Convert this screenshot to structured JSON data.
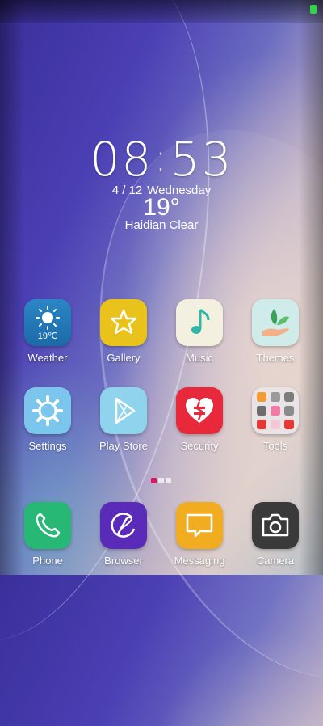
{
  "clock": {
    "hour": "08",
    "minute": "53",
    "date": "4 / 12",
    "weekday": "Wednesday",
    "temperature": "19°",
    "location": "Haidian",
    "condition": "Clear"
  },
  "apps_row1": [
    {
      "label": "Weather",
      "icon": "weather-icon",
      "badge": "19℃"
    },
    {
      "label": "Gallery",
      "icon": "gallery-icon"
    },
    {
      "label": "Music",
      "icon": "music-icon"
    },
    {
      "label": "Themes",
      "icon": "themes-icon"
    }
  ],
  "apps_row2": [
    {
      "label": "Settings",
      "icon": "settings-icon"
    },
    {
      "label": "Play Store",
      "icon": "play-store-icon"
    },
    {
      "label": "Security",
      "icon": "security-icon"
    },
    {
      "label": "Tools",
      "icon": "tools-folder-icon"
    }
  ],
  "dock": [
    {
      "label": "Phone",
      "icon": "phone-icon"
    },
    {
      "label": "Browser",
      "icon": "browser-icon"
    },
    {
      "label": "Messaging",
      "icon": "messaging-icon"
    },
    {
      "label": "Camera",
      "icon": "camera-icon"
    }
  ],
  "page_indicator": {
    "pages": 3,
    "current": 1
  },
  "colors": {
    "status_dot": "#34d34a",
    "page_active": "#d81b60"
  }
}
